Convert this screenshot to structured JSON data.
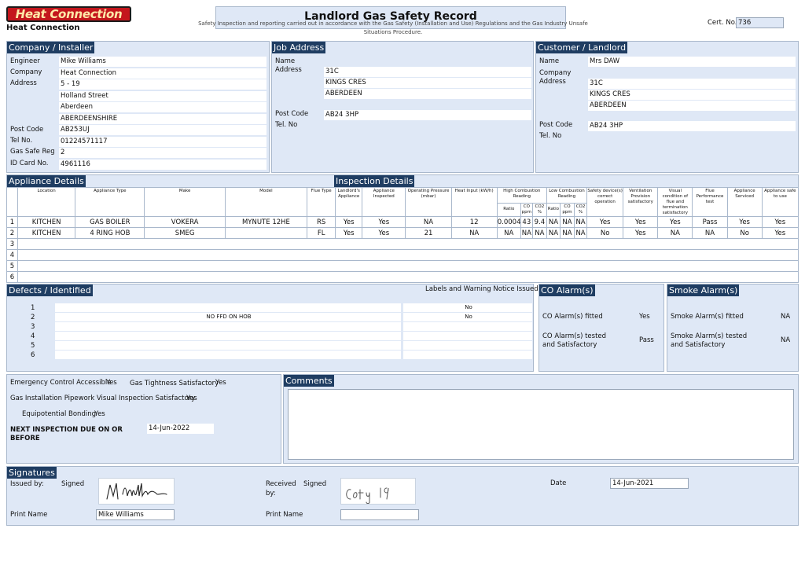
{
  "brand": {
    "logo_text": "Heat Connection",
    "company_name": "Heat Connection",
    "logo_color": "#c4161c"
  },
  "title": "Landlord Gas Safety Record",
  "subtitle": "Safety Inspection and reporting carried out in accordance with the Gas Safety (Installation and Use) Regulations and the Gas Industry Unsafe Situations Procedure.",
  "cert": {
    "label": "Cert. No.",
    "value": "736"
  },
  "installer": {
    "header": "Company / Installer",
    "engineer_label": "Engineer",
    "engineer": "Mike Williams",
    "company_label": "Company",
    "company": "Heat Connection",
    "address_label": "Address",
    "address": [
      "5 - 19",
      "Holland Street",
      "Aberdeen",
      "ABERDEENSHIRE"
    ],
    "postcode_label": "Post Code",
    "postcode": "AB253UJ",
    "tel_label": "Tel No.",
    "tel": "01224571117",
    "gassafe_label": "Gas Safe Reg",
    "gassafe": "2",
    "idcard_label": "ID Card No.",
    "idcard": "4961116"
  },
  "job": {
    "header": "Job Address",
    "name_label": "Name",
    "address_label": "Address",
    "address": [
      "31C",
      "KINGS CRES",
      "ABERDEEN"
    ],
    "postcode_label": "Post Code",
    "postcode": "AB24 3HP",
    "tel_label": "Tel. No"
  },
  "customer": {
    "header": "Customer / Landlord",
    "name_label": "Name",
    "name": "Mrs DAW",
    "company_label": "Company",
    "address_label": "Address",
    "address": [
      "31C",
      "KINGS CRES",
      "ABERDEEN"
    ],
    "postcode_label": "Post Code",
    "postcode": "AB24 3HP",
    "tel_label": "Tel. No"
  },
  "appliances": {
    "header": "Appliance Details",
    "inspection_header": "Inspection Details",
    "columns": {
      "location": "Location",
      "type": "Appliance Type",
      "make": "Make",
      "model": "Model",
      "flue_type": "Flue Type",
      "landlords": "Landlord's Appliance",
      "inspected": "Appliance Inspected",
      "pressure": "Operating Pressure (mbar)",
      "heat_input": "Heat Input (kW/h)",
      "high_comb": "High Combustion Reading",
      "low_comb": "Low Combustion Reading",
      "ratio": "Ratio",
      "co_ppm": "CO ppm",
      "co2_pct": "CO2 %",
      "safety_device": "Safety device(s) correct operation",
      "ventilation": "Ventilation Provision satisfactory",
      "visual_flue": "Visual condition of flue and termination satisfactory",
      "flue_perf": "Flue Performance test",
      "serviced": "Appliance Serviced",
      "safe": "Appliance safe to use"
    },
    "rows": [
      {
        "num": "1",
        "location": "KITCHEN",
        "type": "GAS BOILER",
        "make": "VOKERA",
        "model": "MYNUTE 12HE",
        "flue_type": "RS",
        "landlords": "Yes",
        "inspected": "Yes",
        "pressure": "NA",
        "heat_input": "12",
        "hi_ratio": "0.0004",
        "hi_co": "43",
        "hi_co2": "9.4",
        "lo_ratio": "NA",
        "lo_co": "NA",
        "lo_co2": "NA",
        "safety_device": "Yes",
        "ventilation": "Yes",
        "visual_flue": "Yes",
        "flue_perf": "Pass",
        "serviced": "Yes",
        "safe": "Yes"
      },
      {
        "num": "2",
        "location": "KITCHEN",
        "type": "4 RING HOB",
        "make": "SMEG",
        "model": "",
        "flue_type": "FL",
        "landlords": "Yes",
        "inspected": "Yes",
        "pressure": "21",
        "heat_input": "NA",
        "hi_ratio": "NA",
        "hi_co": "NA",
        "hi_co2": "NA",
        "lo_ratio": "NA",
        "lo_co": "NA",
        "lo_co2": "NA",
        "safety_device": "No",
        "ventilation": "Yes",
        "visual_flue": "NA",
        "flue_perf": "NA",
        "serviced": "No",
        "safe": "Yes"
      },
      {
        "num": "3"
      },
      {
        "num": "4"
      },
      {
        "num": "5"
      },
      {
        "num": "6"
      }
    ]
  },
  "defects": {
    "header": "Defects / Identified",
    "labels_header": "Labels and Warning Notice Issued",
    "rows": [
      {
        "num": "1",
        "text": "",
        "notice": "No"
      },
      {
        "num": "2",
        "text": "NO FFD ON HOB",
        "notice": "No"
      },
      {
        "num": "3",
        "text": "",
        "notice": ""
      },
      {
        "num": "4",
        "text": "",
        "notice": ""
      },
      {
        "num": "5",
        "text": "",
        "notice": ""
      },
      {
        "num": "6",
        "text": "",
        "notice": ""
      }
    ]
  },
  "co_alarm": {
    "header": "CO Alarm(s)",
    "fitted_label": "CO Alarm(s) fitted",
    "fitted": "Yes",
    "tested_label": "CO Alarm(s) tested and Satisfactory",
    "tested": "Pass"
  },
  "smoke_alarm": {
    "header": "Smoke Alarm(s)",
    "fitted_label": "Smoke Alarm(s) fitted",
    "fitted": "NA",
    "tested_label": "Smoke Alarm(s) tested and Satisfactory",
    "tested": "NA"
  },
  "checks": {
    "ecv_label": "Emergency Control Accessible",
    "ecv": "Yes",
    "tightness_label": "Gas Tightness Satisfactory",
    "tightness": "Yes",
    "pipework_label": "Gas Installation Pipework Visual Inspection Satisfactory",
    "pipework": "Yes",
    "bonding_label": "Equipotential Bonding",
    "bonding": "Yes",
    "next_label": "NEXT INSPECTION DUE ON OR BEFORE",
    "next_date": "14-Jun-2022"
  },
  "comments": {
    "header": "Comments",
    "text": ""
  },
  "signatures": {
    "header": "Signatures",
    "issued_label": "Issued by:",
    "signed_label": "Signed",
    "received_label": "Received by:",
    "received_signed_label": "Signed",
    "date_label": "Date",
    "date": "14-Jun-2021",
    "print_name_label": "Print Name",
    "print_name": "Mike Williams",
    "received_print_label": "Print Name",
    "received_print": "",
    "issuer_signature_text": "M Williams",
    "receiver_signature_text": "Conty 19"
  }
}
